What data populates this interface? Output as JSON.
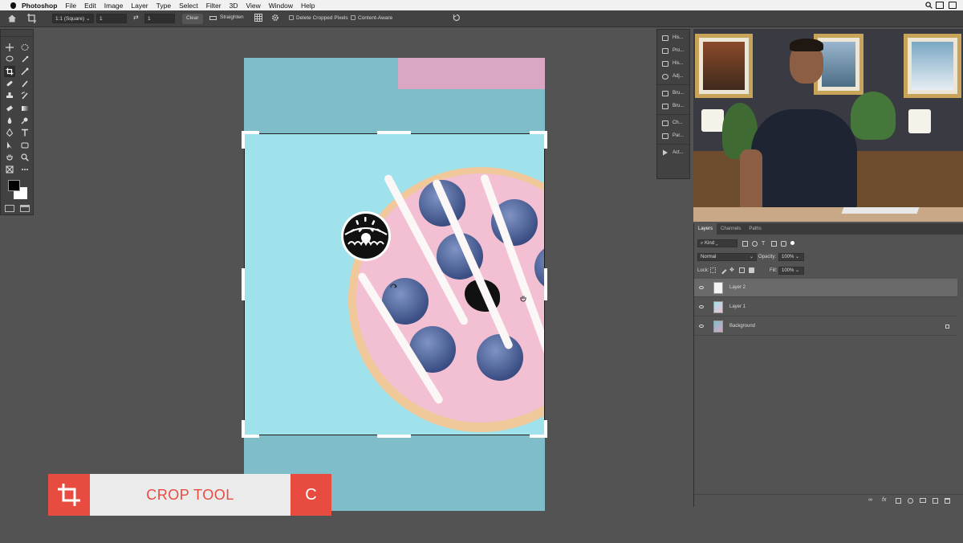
{
  "menubar": {
    "app": "Photoshop",
    "items": [
      "File",
      "Edit",
      "Image",
      "Layer",
      "Type",
      "Select",
      "Filter",
      "3D",
      "View",
      "Window",
      "Help"
    ]
  },
  "options": {
    "ratio": "1:1 (Square)",
    "width": "1",
    "height": "1",
    "clear": "Clear",
    "straighten": "Straighten",
    "delete_cropped": "Delete Cropped Pixels",
    "content_aware": "Content-Aware"
  },
  "dock": {
    "group1": [
      "His...",
      "Pro...",
      "His...",
      "Adj..."
    ],
    "group2": [
      "Bru...",
      "Bru..."
    ],
    "group3": [
      "Ch...",
      "Par..."
    ],
    "group4": [
      "Act..."
    ]
  },
  "layers_panel": {
    "tabs": [
      "Layers",
      "Channels",
      "Paths"
    ],
    "filter": "Kind",
    "blend": "Normal",
    "opacity_label": "Opacity:",
    "opacity": "100%",
    "lock_label": "Lock:",
    "fill_label": "Fill:",
    "fill": "100%",
    "layers": [
      "Layer 2",
      "Layer 1",
      "Background"
    ]
  },
  "caption": {
    "title": "CROP TOOL",
    "shortcut": "C"
  },
  "colors": {
    "accent": "#e84c41",
    "canvas_bg": "#9fe2ec",
    "icing": "#f3bfd2"
  }
}
